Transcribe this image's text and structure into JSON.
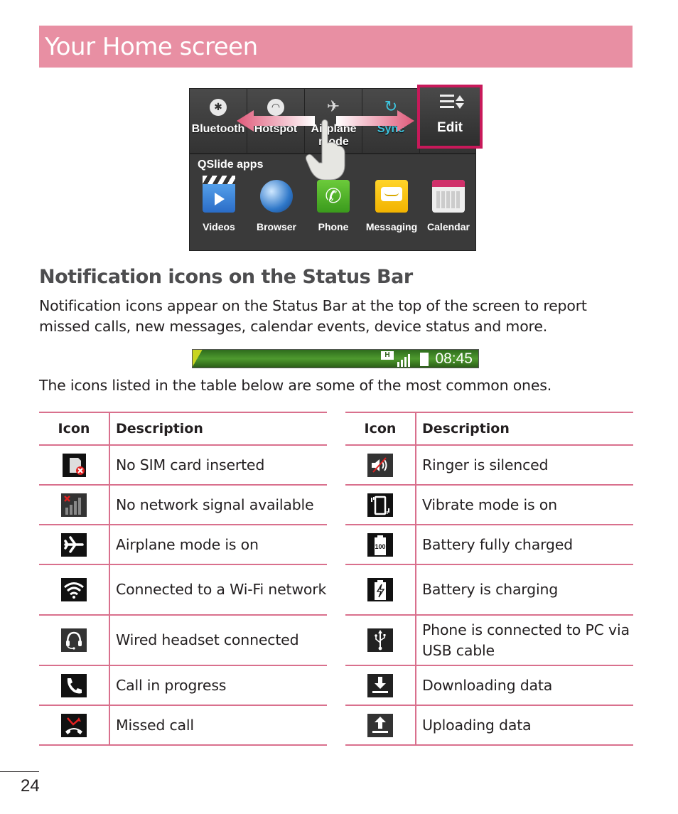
{
  "banner": {
    "title": "Your Home screen"
  },
  "screenshot": {
    "quick_settings": [
      {
        "label": "Bluetooth",
        "icon": "bluetooth-icon",
        "active": false
      },
      {
        "label": "Hotspot",
        "icon": "hotspot-icon",
        "active": false
      },
      {
        "label": "Airplane mode",
        "icon": "airplane-icon",
        "active": false
      },
      {
        "label": "Sync",
        "icon": "sync-icon",
        "active": true
      }
    ],
    "edit_label": "Edit",
    "qslide_title": "QSlide apps",
    "apps": [
      {
        "label": "Videos",
        "icon": "videos-icon"
      },
      {
        "label": "Browser",
        "icon": "browser-icon"
      },
      {
        "label": "Phone",
        "icon": "phone-icon"
      },
      {
        "label": "Messaging",
        "icon": "messaging-icon"
      },
      {
        "label": "Calendar",
        "icon": "calendar-icon"
      }
    ],
    "highlight_color": "#c8195a"
  },
  "section": {
    "heading": "Notification icons on the Status Bar",
    "intro": "Notification icons appear on the Status Bar at the top of the screen to report missed calls, new messages, calendar events, device status and more.",
    "statusbar_time": "08:45",
    "statusbar_network": "H",
    "table_intro": "The icons listed in the table below are some of the most common ones."
  },
  "tables": {
    "header_icon": "Icon",
    "header_description": "Description",
    "left": [
      {
        "icon": "no-sim-icon",
        "description": "No SIM card inserted"
      },
      {
        "icon": "no-signal-icon",
        "description": "No network signal available"
      },
      {
        "icon": "airplane-mode-icon",
        "description": "Airplane mode is on"
      },
      {
        "icon": "wifi-icon",
        "description": "Connected to a Wi-Fi network"
      },
      {
        "icon": "headset-icon",
        "description": "Wired headset connected"
      },
      {
        "icon": "call-icon",
        "description": "Call in progress"
      },
      {
        "icon": "missed-call-icon",
        "description": "Missed call"
      }
    ],
    "right": [
      {
        "icon": "ringer-silenced-icon",
        "description": "Ringer is silenced"
      },
      {
        "icon": "vibrate-icon",
        "description": "Vibrate mode is on"
      },
      {
        "icon": "battery-full-icon",
        "description": "Battery fully charged",
        "badge": "100"
      },
      {
        "icon": "battery-charging-icon",
        "description": "Battery is charging"
      },
      {
        "icon": "usb-icon",
        "description": "Phone is connected to PC via USB cable"
      },
      {
        "icon": "download-icon",
        "description": "Downloading data"
      },
      {
        "icon": "upload-icon",
        "description": "Uploading data"
      }
    ],
    "border_color": "#d9708d"
  },
  "footer": {
    "page_number": "24"
  }
}
